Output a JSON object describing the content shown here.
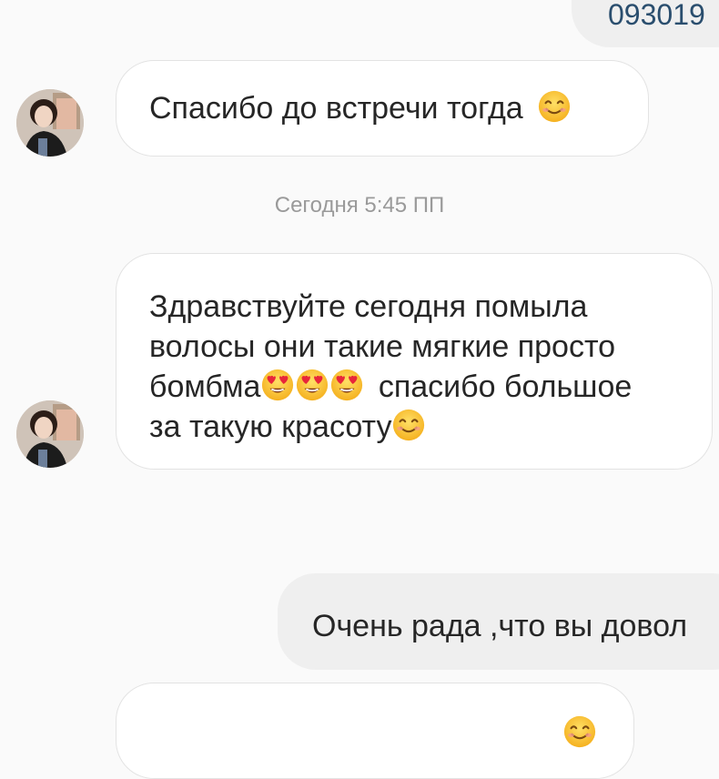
{
  "chat": {
    "top_partial_text": "093019",
    "messages": [
      {
        "direction": "incoming",
        "text": "Спасибо до встречи тогда",
        "trailing_emoji": "smiling-face-emoji"
      },
      {
        "direction": "incoming",
        "lines": [
          "Здравствуйте сегодня помыла",
          "волосы они такие мягкие просто",
          "бомбма",
          "спасибо большое",
          "за такую красоту"
        ],
        "emojis": [
          "heart-eyes-emoji",
          "heart-eyes-emoji",
          "heart-eyes-emoji",
          "smiling-face-emoji"
        ]
      },
      {
        "direction": "outgoing",
        "text": "Очень рада ,что вы довол"
      }
    ],
    "timestamp": "Сегодня 5:45 ПП"
  },
  "colors": {
    "incoming_bubble": "#ffffff",
    "outgoing_bubble": "#efefef",
    "bubble_border": "#e3e3e3",
    "timestamp_text": "#9a9a9a",
    "partial_number_text": "#2a4e6e"
  }
}
